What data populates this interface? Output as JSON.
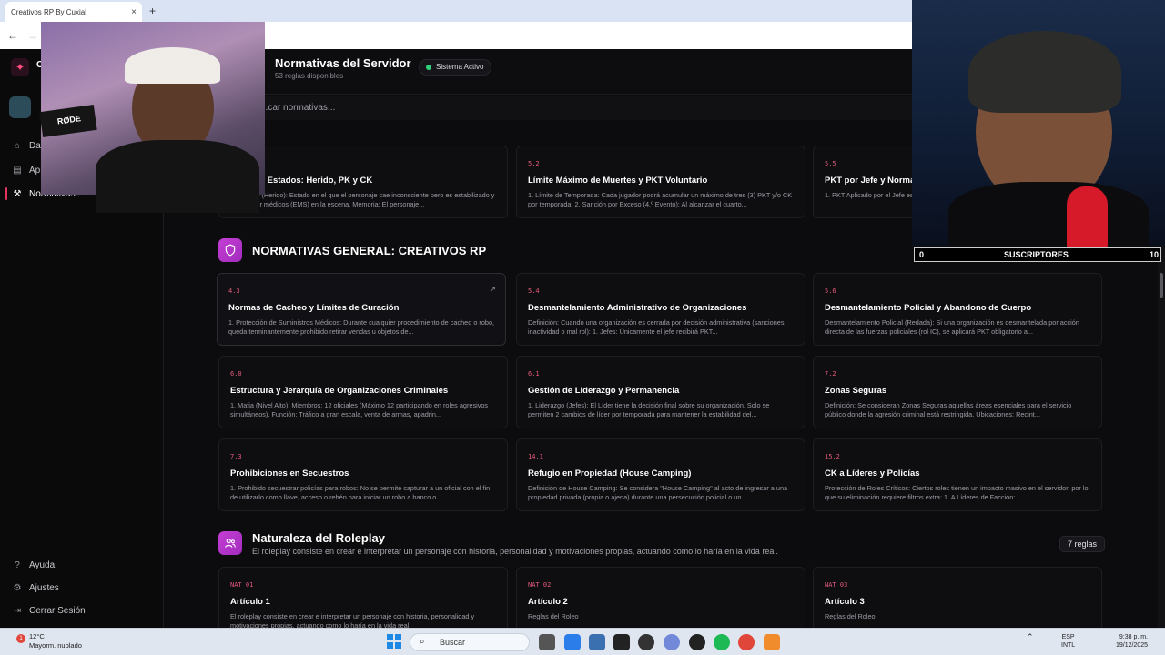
{
  "browser": {
    "tab_title": "Creativos RP By Cuxial",
    "tab_close": "×",
    "new_tab": "+",
    "back": "←",
    "forward": "→"
  },
  "sidebar": {
    "brand_letter": "C",
    "nav": [
      {
        "label": "Da",
        "icon": "home-icon"
      },
      {
        "label": "Ap",
        "icon": "document-icon"
      },
      {
        "label": "Normativas",
        "icon": "gavel-icon"
      }
    ],
    "bottom": [
      {
        "label": "Ayuda",
        "icon": "help-icon"
      },
      {
        "label": "Ajustes",
        "icon": "gear-icon"
      },
      {
        "label": "Cerrar Sesión",
        "icon": "logout-icon"
      }
    ]
  },
  "header": {
    "title": "Normativas del Servidor",
    "subtitle": "53 reglas disponibles",
    "status": "Sistema Activo"
  },
  "search": {
    "placeholder": "...car normativas..."
  },
  "top_cards": [
    {
      "code": "",
      "title": "...nes de Estados: Herido, PK y CK",
      "desc": "1. Abatido (Herido): Estado en el que el personaje cae inconsciente pero es estabilizado y curado por médicos (EMS) en la escena. Memoria: El personaje..."
    },
    {
      "code": "5.2",
      "title": "Límite Máximo de Muertes y PKT Voluntario",
      "desc": "1. Límite de Temporada: Cada jugador podrá acumular un máximo de tres (3) PKT y/o CK por temporada. 2. Sanción por Exceso (4.º Evento): Al alcanzar el cuarto..."
    },
    {
      "code": "5.5",
      "title": "PKT por Jefe y Normas",
      "desc": "1. PKT Aplicado por el Jefe esperar quince (15) días an..."
    }
  ],
  "section_general": {
    "title": "NORMATIVAS GENERAL: CREATIVOS RP"
  },
  "general_cards": [
    {
      "code": "4.3",
      "title": "Normas de Cacheo y Límites de Curación",
      "desc": "1. Protección de Suministros Médicos: Durante cualquier procedimiento de cacheo o robo, queda terminantemente prohibido retirar vendas u objetos de..."
    },
    {
      "code": "5.4",
      "title": "Desmantelamiento Administrativo de Organizaciones",
      "desc": "Definición: Cuando una organización es cerrada por decisión administrativa (sanciones, inactividad o mal rol): 1. Jefes: Únicamente el jefe recibirá PKT..."
    },
    {
      "code": "5.6",
      "title": "Desmantelamiento Policial y Abandono de Cuerpo",
      "desc": "Desmantelamiento Policial (Redada): Si una organización es desmantelada por acción directa de las fuerzas policiales (rol IC), se aplicará PKT obligatorio a..."
    },
    {
      "code": "6.0",
      "title": "Estructura y Jerarquía de Organizaciones Criminales",
      "desc": "1. Mafia (Nivel Alto): Miembros: 12 oficiales (Máximo 12 participando en roles agresivos simultáneos). Función: Tráfico a gran escala, venta de armas, apadrin..."
    },
    {
      "code": "6.1",
      "title": "Gestión de Liderazgo y Permanencia",
      "desc": "1. Liderazgo (Jefes): El Líder tiene la decisión final sobre su organización. Solo se permiten 2 cambios de líder por temporada para mantener la estabilidad del..."
    },
    {
      "code": "7.2",
      "title": "Zonas Seguras",
      "desc": "Definición: Se consideran Zonas Seguras aquellas áreas esenciales para el servicio público donde la agresión criminal está restringida. Ubicaciones: Recint..."
    },
    {
      "code": "7.3",
      "title": "Prohibiciones en Secuestros",
      "desc": "1. Prohibido secuestrar policías para robos: No se permite capturar a un oficial con el fin de utilizarlo como llave, acceso o rehén para iniciar un robo a banco o..."
    },
    {
      "code": "14.1",
      "title": "Refugio en Propiedad (House Camping)",
      "desc": "Definición de House Camping: Se considera \"House Camping\" al acto de ingresar a una propiedad privada (propia o ajena) durante una persecución policial o un..."
    },
    {
      "code": "15.2",
      "title": "CK a Líderes y Policías",
      "desc": "Protección de Roles Críticos: Ciertos roles tienen un impacto masivo en el servidor, por lo que su eliminación requiere filtros extra: 1. A Líderes de Facción:..."
    }
  ],
  "section_roleplay": {
    "title": "Naturaleza del Roleplay",
    "subtitle": "El roleplay consiste en crear e interpretar un personaje con historia, personalidad y motivaciones propias, actuando como lo haría en la vida real.",
    "count": "7 reglas"
  },
  "roleplay_cards": [
    {
      "code": "NAT 01",
      "title": "Artículo 1",
      "desc": "El roleplay consiste en crear e interpretar un personaje con historia, personalidad y motivaciones propias, actuando como lo haría en la vida real."
    },
    {
      "code": "NAT 02",
      "title": "Artículo 2",
      "desc": "Reglas del Roleo"
    },
    {
      "code": "NAT 03",
      "title": "Artículo 3",
      "desc": "Reglas del Roleo"
    }
  ],
  "overlay": {
    "subs_left": "0",
    "subs_label": "SUSCRIPTORES",
    "subs_right": "10",
    "mic_brand": "RØDE"
  },
  "taskbar": {
    "temp": "12°C",
    "weather": "Mayorm. nublado",
    "search": "Buscar",
    "lang1": "ESP",
    "lang2": "INTL",
    "time": "9:38 p. m.",
    "date": "19/12/2025",
    "notif": "1",
    "colors": [
      "#2b7de9",
      "#f2b82c",
      "#23a55a",
      "#7289da",
      "#1db954",
      "#e0463a",
      "#f08c2c",
      "#222222",
      "#6a4fd8"
    ]
  }
}
